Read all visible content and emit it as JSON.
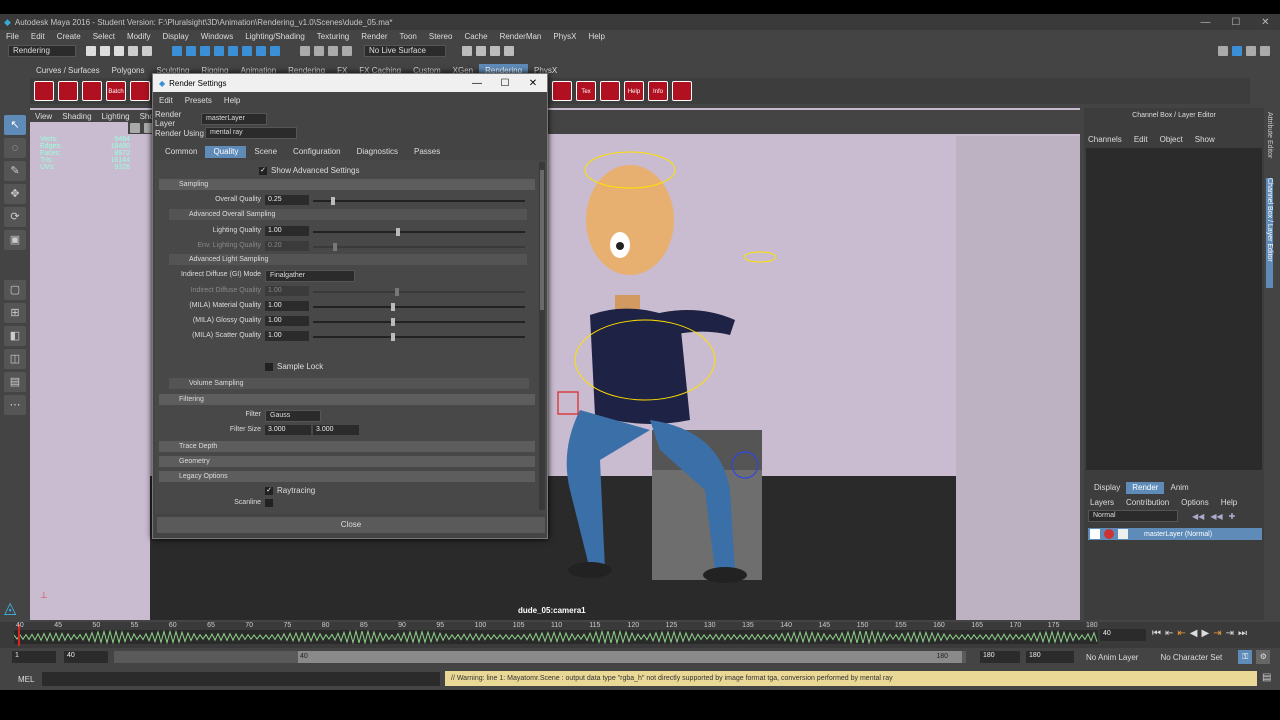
{
  "app": {
    "title": "Autodesk Maya 2016 - Student Version: F:\\Pluralsight\\3D\\Animation\\Rendering_v1.0\\Scenes\\dude_05.ma*"
  },
  "menubar": [
    "File",
    "Edit",
    "Create",
    "Select",
    "Modify",
    "Display",
    "Windows",
    "Lighting/Shading",
    "Texturing",
    "Render",
    "Toon",
    "Stereo",
    "Cache",
    "RenderMan",
    "PhysX",
    "Help"
  ],
  "statusline": {
    "menuset": "Rendering",
    "live_surface": "No Live Surface"
  },
  "shelf": {
    "tabs": [
      "Curves / Surfaces",
      "Polygons",
      "Sculpting",
      "Rigging",
      "Animation",
      "Rendering",
      "FX",
      "FX Caching",
      "Custom",
      "XGen",
      "Rendering",
      "PhysX"
    ],
    "active_tab": "Rendering",
    "icons": [
      "Batch",
      "Tex",
      "Help",
      "Info"
    ]
  },
  "viewport": {
    "menus": [
      "View",
      "Shading",
      "Lighting",
      "Show"
    ],
    "hud": [
      {
        "label": "Verts:",
        "value": "9484"
      },
      {
        "label": "Edges:",
        "value": "18480"
      },
      {
        "label": "Faces:",
        "value": "8972"
      },
      {
        "label": "Tris:",
        "value": "16144"
      },
      {
        "label": "UVs:",
        "value": "9326"
      }
    ],
    "camera": "dude_05:camera1"
  },
  "render_settings": {
    "title": "Render Settings",
    "menus": [
      "Edit",
      "Presets",
      "Help"
    ],
    "render_layer_label": "Render Layer",
    "render_layer_value": "masterLayer",
    "render_using_label": "Render Using",
    "render_using_value": "mental ray",
    "tabs": [
      "Common",
      "Quality",
      "Scene",
      "Configuration",
      "Diagnostics",
      "Passes"
    ],
    "active_tab": "Quality",
    "show_advanced": "Show Advanced Settings",
    "sampling": "Sampling",
    "overall_quality_label": "Overall Quality",
    "overall_quality": "0.25",
    "advanced_overall": "Advanced Overall Sampling",
    "lighting_quality_label": "Lighting Quality",
    "lighting_quality": "1.00",
    "env_lighting_label": "Env. Lighting Quality",
    "env_lighting": "0.20",
    "advanced_light": "Advanced Light Sampling",
    "indirect_mode_label": "Indirect Diffuse (GI) Mode",
    "indirect_mode": "Finalgather",
    "indirect_quality_label": "Indirect Diffuse Quality",
    "indirect_quality": "1.00",
    "mila_material_label": "(MILA) Material Quality",
    "mila_material": "1.00",
    "mila_glossy_label": "(MILA) Glossy Quality",
    "mila_glossy": "1.00",
    "mila_scatter_label": "(MILA) Scatter Quality",
    "mila_scatter": "1.00",
    "sample_lock": "Sample Lock",
    "volume_sampling": "Volume Sampling",
    "filtering": "Filtering",
    "filter_label": "Filter",
    "filter": "Gauss",
    "filter_size_label": "Filter Size",
    "filter_size_x": "3.000",
    "filter_size_y": "3.000",
    "trace_depth": "Trace Depth",
    "geometry": "Geometry",
    "legacy_options": "Legacy Options",
    "raytracing": "Raytracing",
    "scanline": "Scanline",
    "close": "Close"
  },
  "channel_box": {
    "title": "Channel Box / Layer Editor",
    "menus": [
      "Channels",
      "Edit",
      "Object",
      "Show"
    ],
    "side_tabs": [
      "Attribute Editor",
      "Channel Box / Layer Editor"
    ]
  },
  "layer_editor": {
    "tabs": [
      "Display",
      "Render",
      "Anim"
    ],
    "active_tab": "Render",
    "menus": [
      "Layers",
      "Contribution",
      "Options",
      "Help"
    ],
    "blend": "Normal",
    "layer": "masterLayer (Normal)"
  },
  "timeline": {
    "ticks": [
      "40",
      "45",
      "50",
      "55",
      "60",
      "65",
      "70",
      "75",
      "80",
      "85",
      "90",
      "95",
      "100",
      "105",
      "110",
      "115",
      "120",
      "125",
      "130",
      "135",
      "140",
      "145",
      "150",
      "155",
      "160",
      "165",
      "170",
      "175",
      "180"
    ],
    "current_frame": "40",
    "current_marker": "40"
  },
  "range": {
    "start": "1",
    "inner_start": "40",
    "slider_left": "40",
    "slider_right": "180",
    "inner_end": "180",
    "end": "180",
    "anim_layer": "No Anim Layer",
    "character_set": "No Character Set"
  },
  "command": {
    "lang": "MEL",
    "warning": "// Warning: line 1: Mayatomr.Scene : output data type \"rgba_h\" not directly supported by image format tga, conversion performed by mental ray"
  }
}
